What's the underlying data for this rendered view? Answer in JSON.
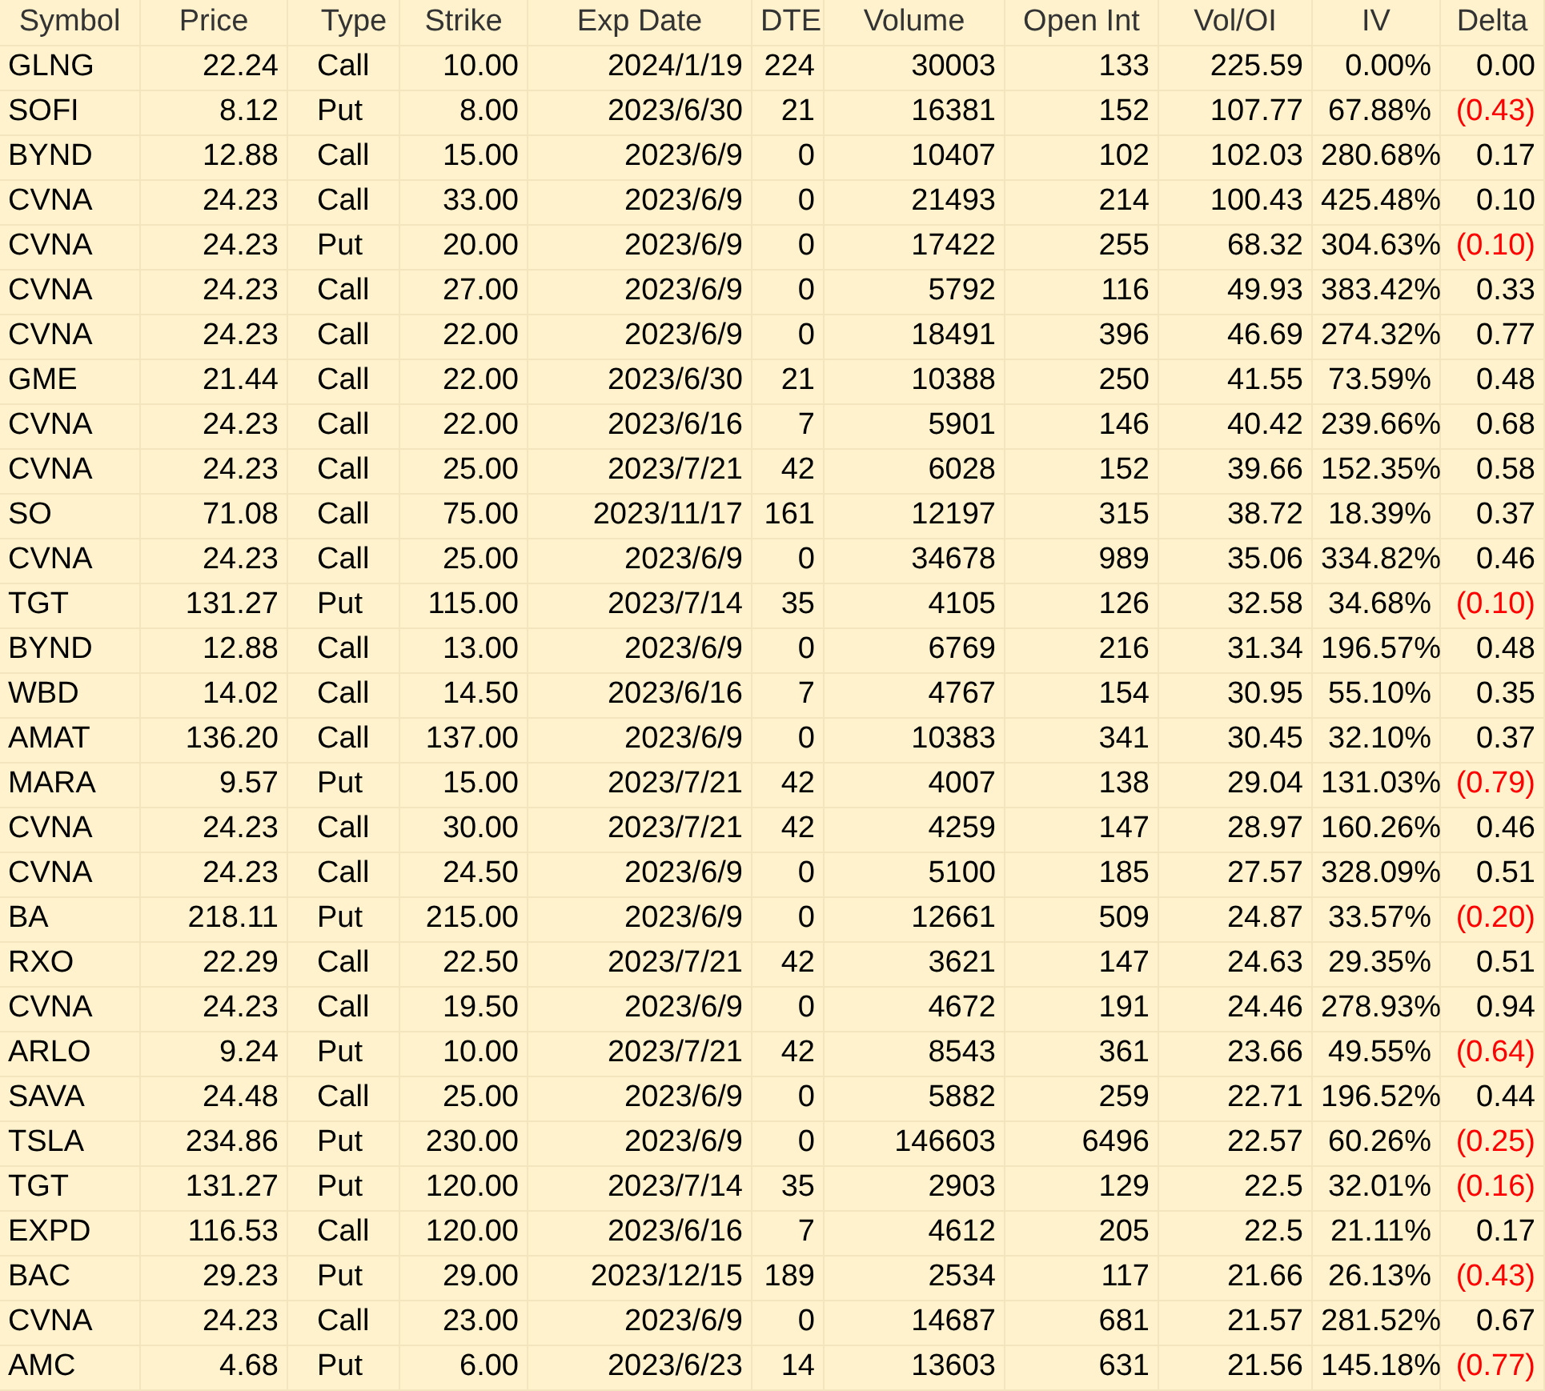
{
  "table": {
    "columns": [
      "Symbol",
      "Price",
      "Type",
      "Strike",
      "Exp Date",
      "DTE",
      "Volume",
      "Open Int",
      "Vol/OI",
      "IV",
      "Delta"
    ],
    "rows": [
      {
        "cells": [
          "GLNG",
          "22.24",
          "Call",
          "10.00",
          "2024/1/19",
          "224",
          "30003",
          "133",
          "225.59",
          "0.00%",
          "0.00"
        ],
        "delta_negative": false
      },
      {
        "cells": [
          "SOFI",
          "8.12",
          "Put",
          "8.00",
          "2023/6/30",
          "21",
          "16381",
          "152",
          "107.77",
          "67.88%",
          "(0.43)"
        ],
        "delta_negative": true
      },
      {
        "cells": [
          "BYND",
          "12.88",
          "Call",
          "15.00",
          "2023/6/9",
          "0",
          "10407",
          "102",
          "102.03",
          "280.68%",
          "0.17"
        ],
        "delta_negative": false
      },
      {
        "cells": [
          "CVNA",
          "24.23",
          "Call",
          "33.00",
          "2023/6/9",
          "0",
          "21493",
          "214",
          "100.43",
          "425.48%",
          "0.10"
        ],
        "delta_negative": false
      },
      {
        "cells": [
          "CVNA",
          "24.23",
          "Put",
          "20.00",
          "2023/6/9",
          "0",
          "17422",
          "255",
          "68.32",
          "304.63%",
          "(0.10)"
        ],
        "delta_negative": true
      },
      {
        "cells": [
          "CVNA",
          "24.23",
          "Call",
          "27.00",
          "2023/6/9",
          "0",
          "5792",
          "116",
          "49.93",
          "383.42%",
          "0.33"
        ],
        "delta_negative": false
      },
      {
        "cells": [
          "CVNA",
          "24.23",
          "Call",
          "22.00",
          "2023/6/9",
          "0",
          "18491",
          "396",
          "46.69",
          "274.32%",
          "0.77"
        ],
        "delta_negative": false
      },
      {
        "cells": [
          "GME",
          "21.44",
          "Call",
          "22.00",
          "2023/6/30",
          "21",
          "10388",
          "250",
          "41.55",
          "73.59%",
          "0.48"
        ],
        "delta_negative": false
      },
      {
        "cells": [
          "CVNA",
          "24.23",
          "Call",
          "22.00",
          "2023/6/16",
          "7",
          "5901",
          "146",
          "40.42",
          "239.66%",
          "0.68"
        ],
        "delta_negative": false
      },
      {
        "cells": [
          "CVNA",
          "24.23",
          "Call",
          "25.00",
          "2023/7/21",
          "42",
          "6028",
          "152",
          "39.66",
          "152.35%",
          "0.58"
        ],
        "delta_negative": false
      },
      {
        "cells": [
          "SO",
          "71.08",
          "Call",
          "75.00",
          "2023/11/17",
          "161",
          "12197",
          "315",
          "38.72",
          "18.39%",
          "0.37"
        ],
        "delta_negative": false
      },
      {
        "cells": [
          "CVNA",
          "24.23",
          "Call",
          "25.00",
          "2023/6/9",
          "0",
          "34678",
          "989",
          "35.06",
          "334.82%",
          "0.46"
        ],
        "delta_negative": false
      },
      {
        "cells": [
          "TGT",
          "131.27",
          "Put",
          "115.00",
          "2023/7/14",
          "35",
          "4105",
          "126",
          "32.58",
          "34.68%",
          "(0.10)"
        ],
        "delta_negative": true
      },
      {
        "cells": [
          "BYND",
          "12.88",
          "Call",
          "13.00",
          "2023/6/9",
          "0",
          "6769",
          "216",
          "31.34",
          "196.57%",
          "0.48"
        ],
        "delta_negative": false
      },
      {
        "cells": [
          "WBD",
          "14.02",
          "Call",
          "14.50",
          "2023/6/16",
          "7",
          "4767",
          "154",
          "30.95",
          "55.10%",
          "0.35"
        ],
        "delta_negative": false
      },
      {
        "cells": [
          "AMAT",
          "136.20",
          "Call",
          "137.00",
          "2023/6/9",
          "0",
          "10383",
          "341",
          "30.45",
          "32.10%",
          "0.37"
        ],
        "delta_negative": false
      },
      {
        "cells": [
          "MARA",
          "9.57",
          "Put",
          "15.00",
          "2023/7/21",
          "42",
          "4007",
          "138",
          "29.04",
          "131.03%",
          "(0.79)"
        ],
        "delta_negative": true
      },
      {
        "cells": [
          "CVNA",
          "24.23",
          "Call",
          "30.00",
          "2023/7/21",
          "42",
          "4259",
          "147",
          "28.97",
          "160.26%",
          "0.46"
        ],
        "delta_negative": false
      },
      {
        "cells": [
          "CVNA",
          "24.23",
          "Call",
          "24.50",
          "2023/6/9",
          "0",
          "5100",
          "185",
          "27.57",
          "328.09%",
          "0.51"
        ],
        "delta_negative": false
      },
      {
        "cells": [
          "BA",
          "218.11",
          "Put",
          "215.00",
          "2023/6/9",
          "0",
          "12661",
          "509",
          "24.87",
          "33.57%",
          "(0.20)"
        ],
        "delta_negative": true
      },
      {
        "cells": [
          "RXO",
          "22.29",
          "Call",
          "22.50",
          "2023/7/21",
          "42",
          "3621",
          "147",
          "24.63",
          "29.35%",
          "0.51"
        ],
        "delta_negative": false
      },
      {
        "cells": [
          "CVNA",
          "24.23",
          "Call",
          "19.50",
          "2023/6/9",
          "0",
          "4672",
          "191",
          "24.46",
          "278.93%",
          "0.94"
        ],
        "delta_negative": false
      },
      {
        "cells": [
          "ARLO",
          "9.24",
          "Put",
          "10.00",
          "2023/7/21",
          "42",
          "8543",
          "361",
          "23.66",
          "49.55%",
          "(0.64)"
        ],
        "delta_negative": true
      },
      {
        "cells": [
          "SAVA",
          "24.48",
          "Call",
          "25.00",
          "2023/6/9",
          "0",
          "5882",
          "259",
          "22.71",
          "196.52%",
          "0.44"
        ],
        "delta_negative": false
      },
      {
        "cells": [
          "TSLA",
          "234.86",
          "Put",
          "230.00",
          "2023/6/9",
          "0",
          "146603",
          "6496",
          "22.57",
          "60.26%",
          "(0.25)"
        ],
        "delta_negative": true
      },
      {
        "cells": [
          "TGT",
          "131.27",
          "Put",
          "120.00",
          "2023/7/14",
          "35",
          "2903",
          "129",
          "22.5",
          "32.01%",
          "(0.16)"
        ],
        "delta_negative": true
      },
      {
        "cells": [
          "EXPD",
          "116.53",
          "Call",
          "120.00",
          "2023/6/16",
          "7",
          "4612",
          "205",
          "22.5",
          "21.11%",
          "0.17"
        ],
        "delta_negative": false
      },
      {
        "cells": [
          "BAC",
          "29.23",
          "Put",
          "29.00",
          "2023/12/15",
          "189",
          "2534",
          "117",
          "21.66",
          "26.13%",
          "(0.43)"
        ],
        "delta_negative": true
      },
      {
        "cells": [
          "CVNA",
          "24.23",
          "Call",
          "23.00",
          "2023/6/9",
          "0",
          "14687",
          "681",
          "21.57",
          "281.52%",
          "0.67"
        ],
        "delta_negative": false
      },
      {
        "cells": [
          "AMC",
          "4.68",
          "Put",
          "6.00",
          "2023/6/23",
          "14",
          "13603",
          "631",
          "21.56",
          "145.18%",
          "(0.77)"
        ],
        "delta_negative": true
      }
    ]
  }
}
